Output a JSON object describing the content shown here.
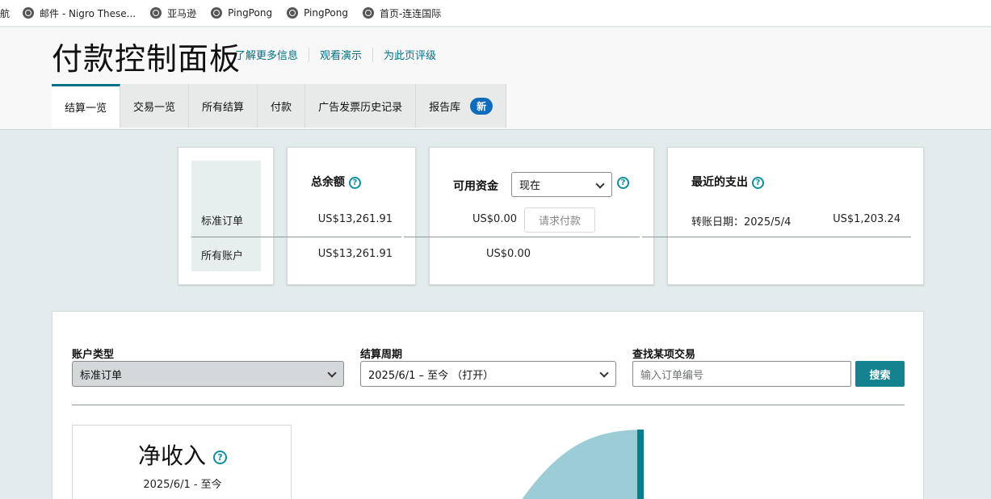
{
  "bookmarks": [
    {
      "label": "航",
      "icon": "none"
    },
    {
      "label": "邮件 - Nigro These...",
      "icon": "globe-icon"
    },
    {
      "label": "亚马逊",
      "icon": "globe-icon"
    },
    {
      "label": "PingPong",
      "icon": "globe-icon"
    },
    {
      "label": "PingPong",
      "icon": "globe-icon"
    },
    {
      "label": "首页-连连国际",
      "icon": "globe-icon"
    }
  ],
  "header": {
    "title": "付款控制面板",
    "links": [
      "了解更多信息",
      "观看演示",
      "为此页评级"
    ]
  },
  "tabs": [
    {
      "label": "结算一览",
      "active": true
    },
    {
      "label": "交易一览"
    },
    {
      "label": "所有结算"
    },
    {
      "label": "付款"
    },
    {
      "label": "广告发票历史记录"
    },
    {
      "label": "报告库",
      "badge": "新"
    }
  ],
  "summary": {
    "row_labels": [
      "标准订单",
      "所有账户"
    ],
    "total_balance": {
      "title": "总余额",
      "standard": "US$13,261.91",
      "all": "US$13,261.91"
    },
    "available_funds": {
      "title": "可用资金",
      "select_value": "现在",
      "standard": "US$0.00",
      "all": "US$0.00",
      "request_button": "请求付款"
    },
    "recent_payout": {
      "title": "最近的支出",
      "transfer_date": "转账日期：2025/5/4",
      "amount": "US$1,203.24"
    }
  },
  "filters": {
    "account_type": {
      "label": "账户类型",
      "value": "标准订单"
    },
    "settlement_period": {
      "label": "结算周期",
      "value": "2025/6/1 – 至今  （打开）"
    },
    "find_transaction": {
      "label": "查找某项交易",
      "placeholder": "输入订单编号",
      "button": "搜索"
    }
  },
  "net_income": {
    "title": "净收入",
    "date_range": "2025/6/1 - 至今"
  },
  "colors": {
    "accent": "#007185",
    "badge": "#0f6cbd",
    "search_button": "#15828f",
    "chart_fill": "#9ccdd6",
    "chart_bar": "#0b7c8c"
  }
}
